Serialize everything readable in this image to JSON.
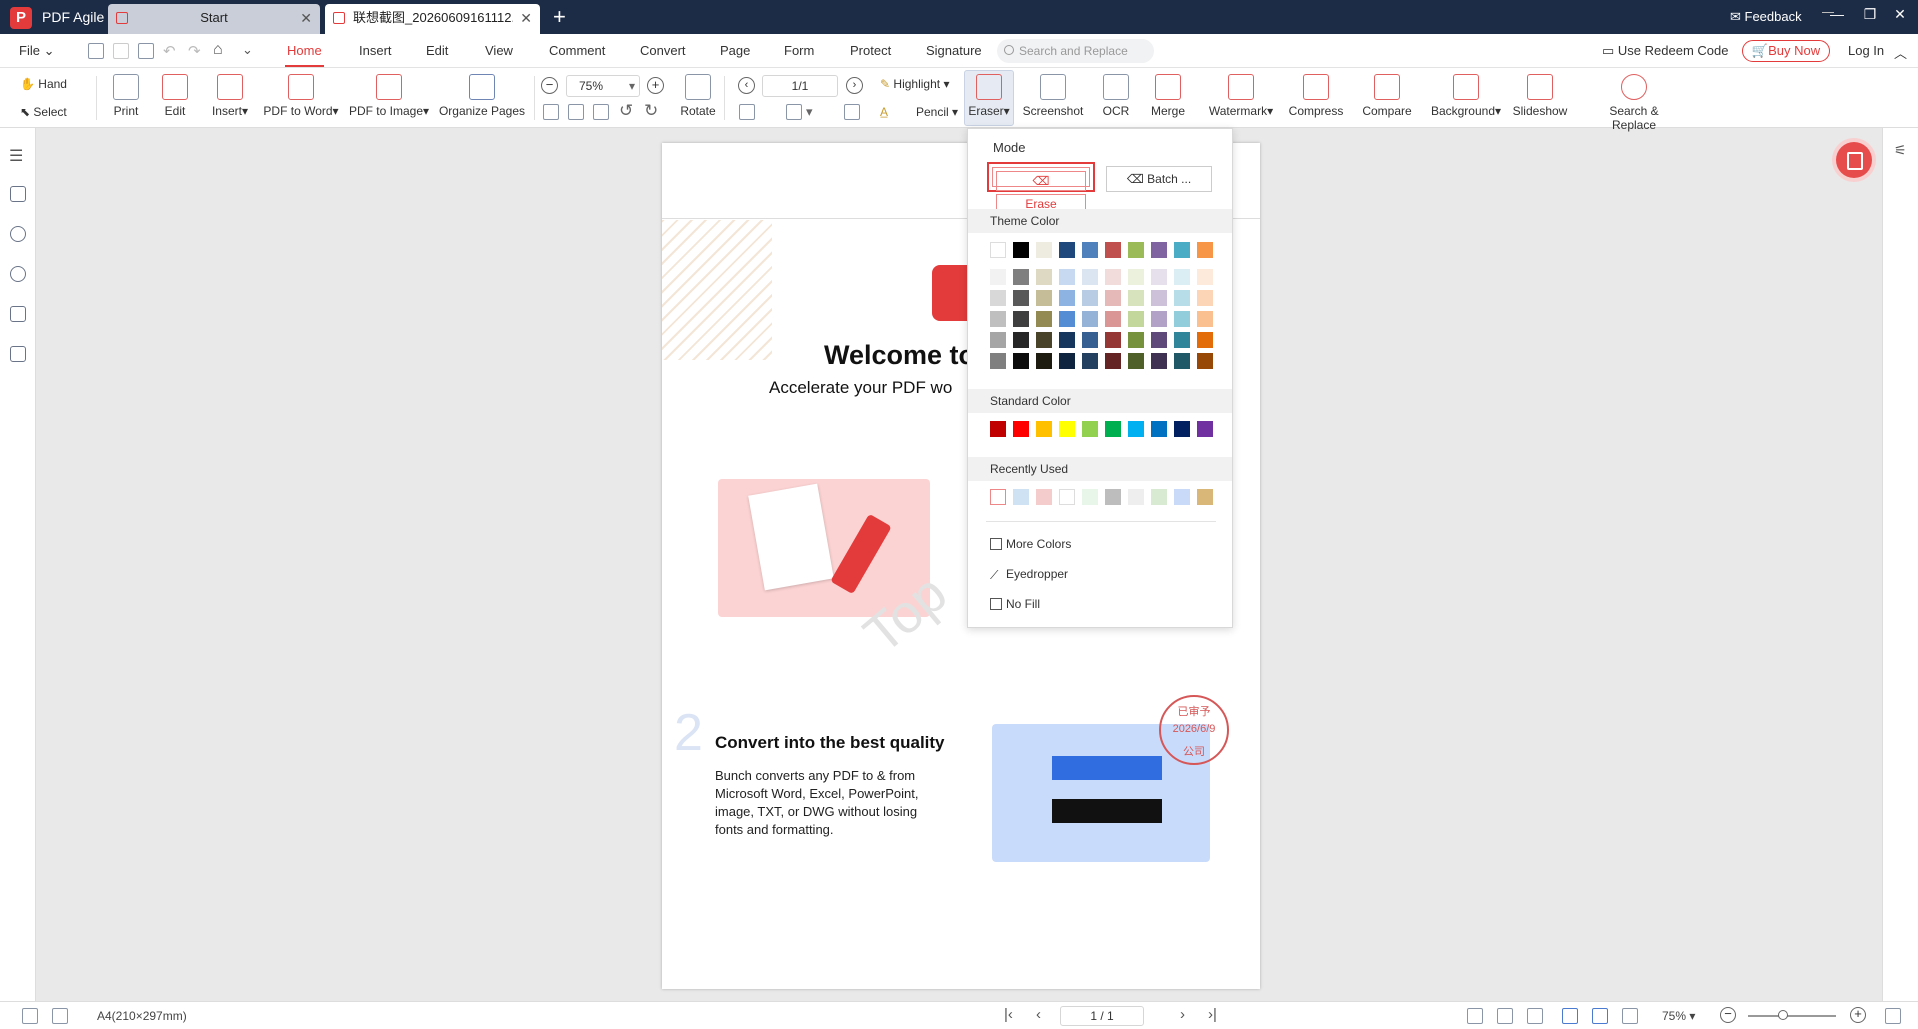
{
  "app": {
    "name": "PDF Agile",
    "logo_letter": "P"
  },
  "tabs": [
    {
      "label": "Start"
    },
    {
      "label": "联想截图_20260609161112...."
    }
  ],
  "titlebar": {
    "feedback": "Feedback",
    "minimize": "—",
    "restore": "❐",
    "close": "✕",
    "newtab": "+"
  },
  "menubar": {
    "file": "File",
    "items": [
      "Home",
      "Insert",
      "Edit",
      "View",
      "Comment",
      "Convert",
      "Page",
      "Form",
      "Protect",
      "Signature"
    ],
    "search_placeholder": "Search and Replace",
    "redeem": "Use Redeem Code",
    "buy": "Buy Now",
    "login": "Log In"
  },
  "toolbar": {
    "hand": "Hand",
    "select": "Select",
    "print": "Print",
    "edit": "Edit",
    "insert": "Insert",
    "pdf_to_word": "PDF to Word",
    "pdf_to_image": "PDF to Image",
    "organize": "Organize Pages",
    "zoom": "75%",
    "page": "1/1",
    "rotate": "Rotate",
    "highlight": "Highlight",
    "pencil": "Pencil",
    "eraser": "Eraser",
    "screenshot": "Screenshot",
    "ocr": "OCR",
    "merge": "Merge",
    "watermark": "Watermark",
    "compress": "Compress",
    "compare": "Compare",
    "background": "Background",
    "slideshow": "Slideshow",
    "search_replace": "Search & Replace"
  },
  "dropdown": {
    "mode_label": "Mode",
    "erase": "Erase",
    "batch": "Batch ...",
    "theme_color": "Theme Color",
    "standard_color": "Standard Color",
    "recently_used": "Recently Used",
    "more_colors": "More Colors",
    "eyedropper": "Eyedropper",
    "no_fill": "No Fill",
    "theme_top": [
      "#ffffff",
      "#000000",
      "#eeece1",
      "#1f497d",
      "#4f81bd",
      "#c0504d",
      "#9bbb59",
      "#8064a2",
      "#4bacc6",
      "#f79646"
    ],
    "theme_shades": [
      [
        "#f2f2f2",
        "#7f7f7f",
        "#ddd9c3",
        "#c6d9f0",
        "#dbe5f1",
        "#f2dcdb",
        "#ebf1dd",
        "#e5e0ec",
        "#dbeef3",
        "#fdeada"
      ],
      [
        "#d8d8d8",
        "#595959",
        "#c4bd97",
        "#8db3e2",
        "#b8cce4",
        "#e5b9b7",
        "#d7e3bc",
        "#ccc1d9",
        "#b7dde8",
        "#fbd5b5"
      ],
      [
        "#bfbfbf",
        "#3f3f3f",
        "#938953",
        "#548dd4",
        "#95b3d7",
        "#d99694",
        "#c3d69b",
        "#b2a2c7",
        "#92cddc",
        "#fac08f"
      ],
      [
        "#a5a5a5",
        "#262626",
        "#494429",
        "#17365d",
        "#366092",
        "#953734",
        "#76923c",
        "#5f497a",
        "#31859b",
        "#e36c09"
      ],
      [
        "#7f7f7f",
        "#0c0c0c",
        "#1d1b10",
        "#0f243e",
        "#244061",
        "#632423",
        "#4f6128",
        "#3f3151",
        "#205867",
        "#974806"
      ]
    ],
    "standard": [
      "#c00000",
      "#ff0000",
      "#ffc000",
      "#ffff00",
      "#92d050",
      "#00b050",
      "#00b0f0",
      "#0070c0",
      "#002060",
      "#7030a0"
    ],
    "recent": [
      "#ffffff",
      "#cfe2f3",
      "#f4cccc",
      "#ffffff",
      "#e8f5e9",
      "#bdbdbd",
      "#eeeeee",
      "#d9ead3",
      "#c9daf8",
      "#d9b779"
    ]
  },
  "document": {
    "welcome": "Welcome to",
    "subtitle": "Accelerate your PDF wo",
    "watermark": "Top",
    "step_number": "2",
    "heading": "Convert into the best quality",
    "body": [
      "Bunch converts any PDF to & from",
      "Microsoft Word, Excel, PowerPoint,",
      "image, TXT, or DWG without losing",
      "fonts and formatting."
    ],
    "stamp": [
      "已审予",
      "2026/6/9",
      "公司"
    ]
  },
  "statusbar": {
    "size": "A4(210×297mm)",
    "page": "1 / 1",
    "zoom": "75%"
  }
}
